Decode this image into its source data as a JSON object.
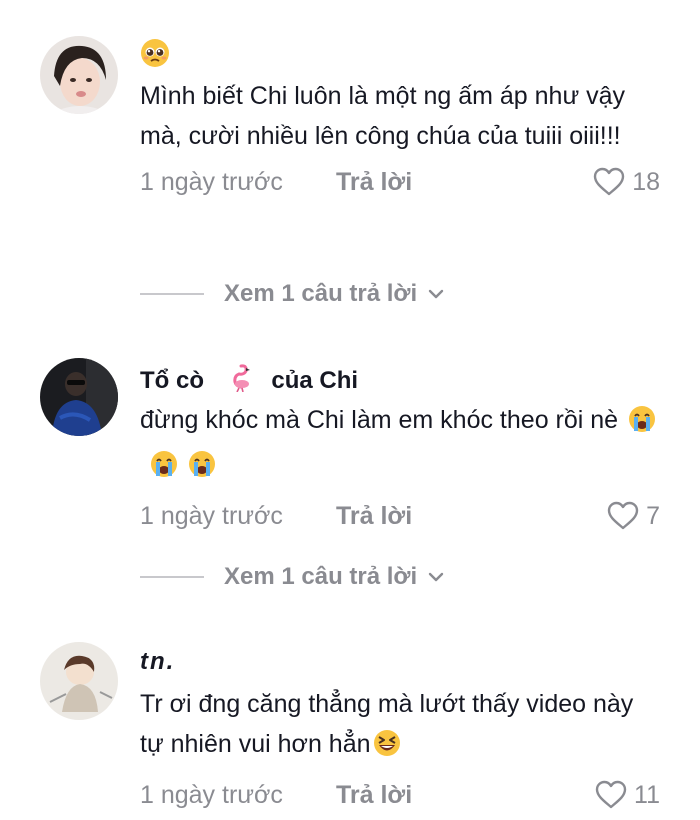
{
  "comments": [
    {
      "username_emoji": "pleading-face-emoji",
      "text": "Mình biết Chi luôn là một ng ấm áp như vậy mà, cười nhiều lên công chúa của tuiii oiii!!!",
      "time": "1 ngày trước",
      "reply_label": "Trả lời",
      "likes": "18",
      "view_replies": "Xem 1 câu trả lời"
    },
    {
      "username_part1": "Tổ cò",
      "username_part2": "của Chi",
      "username_emoji": "flamingo-emoji",
      "text": "đừng khóc mà Chi làm em khóc theo rồi nè",
      "text_emojis": [
        "crying-face-emoji",
        "crying-face-emoji",
        "crying-face-emoji"
      ],
      "time": "1 ngày trước",
      "reply_label": "Trả lời",
      "likes": "7",
      "view_replies": "Xem 1 câu trả lời"
    },
    {
      "username": "tn.",
      "text": "Tr ơi đng căng thẳng mà lướt thấy video này tự nhiên vui hơn hẳn",
      "text_emojis": [
        "squinting-laughing-emoji"
      ],
      "time": "1 ngày trước",
      "reply_label": "Trả lời",
      "likes": "11"
    }
  ],
  "colors": {
    "primary_text": "#161823",
    "secondary_text": "#8a8b91",
    "divider": "#c8c8cc"
  }
}
